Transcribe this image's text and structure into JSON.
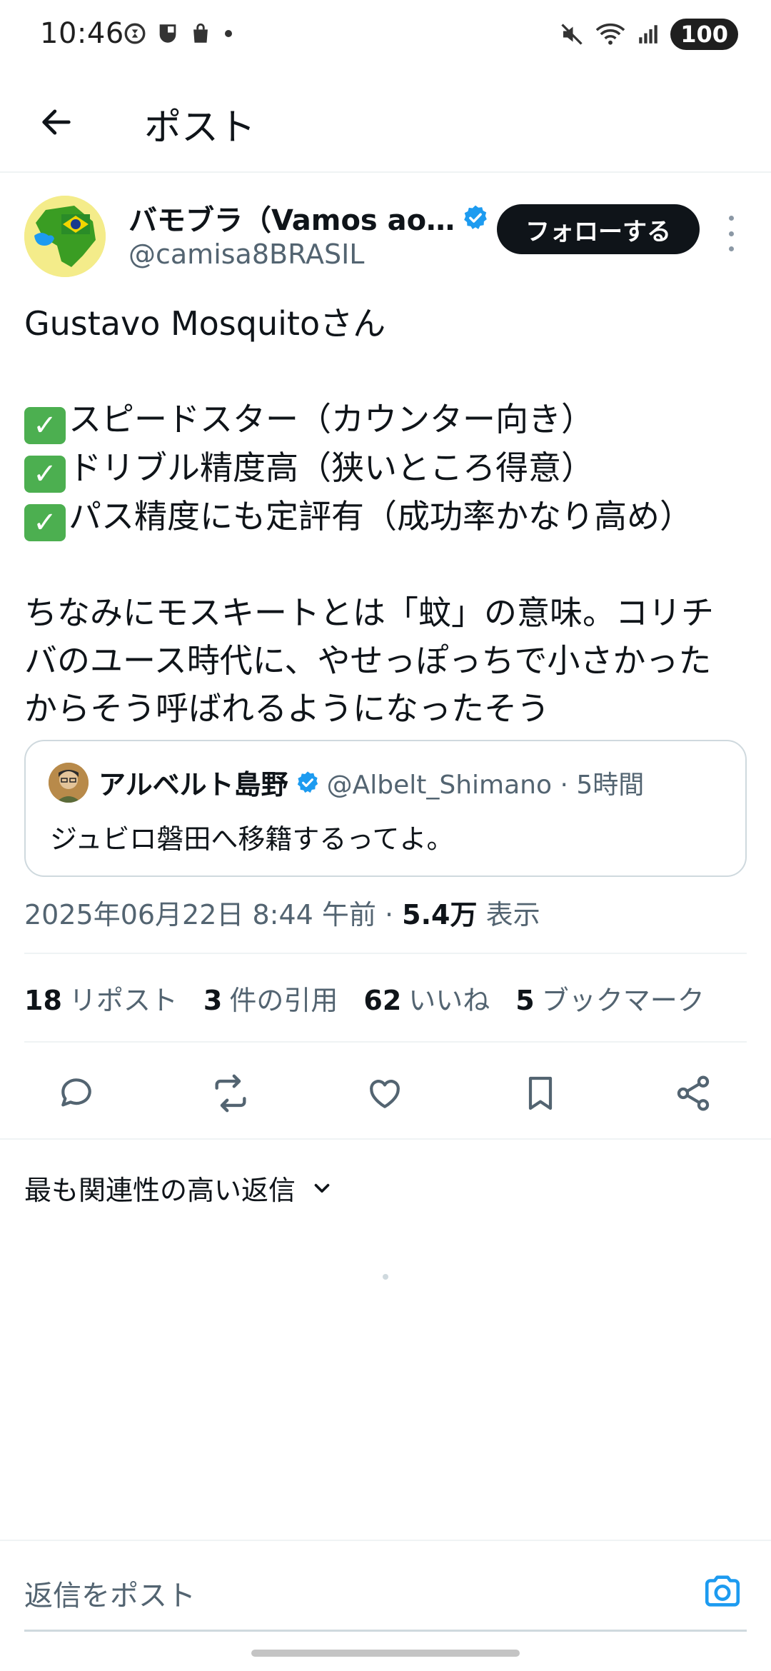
{
  "status_bar": {
    "time": "10:46",
    "battery": "100"
  },
  "app_bar": {
    "title": "ポスト"
  },
  "post": {
    "display_name": "バモブラ（Vamos ao…",
    "handle": "@camisa8BRASIL",
    "follow_label": "フォローする",
    "body": {
      "line1": "Gustavo Mosquitoさん",
      "check1": "スピードスター（カウンター向き）",
      "check2": "ドリブル精度高（狭いところ得意）",
      "check3": "パス精度にも定評有（成功率かなり高め）",
      "paragraph_line1": "ちなみにモスキートとは「蚊」の意味。コリチ",
      "paragraph_line2": "バのユース時代に、やせっぽっちで小さかった",
      "paragraph_line3": "からそう呼ばれるようになったそう"
    },
    "quote": {
      "name": "アルベルト島野",
      "meta": "@Albelt_Shimano · 5時間",
      "text": "ジュビロ磐田へ移籍するってよ。"
    },
    "timestamp": "2025年06月22日 8:44 午前 · ",
    "views_count": "5.4万",
    "views_label": " 表示",
    "stats": [
      {
        "count": "18",
        "label": "リポスト"
      },
      {
        "count": "3",
        "label": "件の引用"
      },
      {
        "count": "62",
        "label": "いいね"
      },
      {
        "count": "5",
        "label": "ブックマーク"
      }
    ]
  },
  "replies": {
    "sort_label": "最も関連性の高い返信"
  },
  "reply_bar": {
    "placeholder": "返信をポスト"
  },
  "icons": {
    "verified": "verified-badge-icon",
    "reply": "reply-icon",
    "repost": "repost-icon",
    "like": "heart-icon",
    "bookmark": "bookmark-icon",
    "share": "share-icon",
    "camera": "camera-icon"
  },
  "colors": {
    "accent": "#1d9bf0",
    "text_primary": "#0f1419",
    "text_secondary": "#536471",
    "follow_bg": "#0f1419",
    "checkmark_green": "#4caf50"
  }
}
